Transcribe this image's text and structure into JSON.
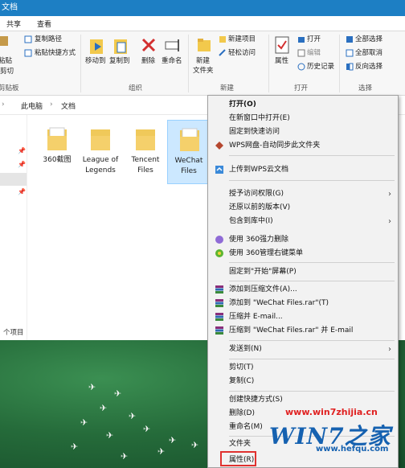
{
  "window": {
    "title": "文档"
  },
  "tabs": [
    "共享",
    "查看"
  ],
  "ribbon": {
    "clipboard": {
      "paste": "粘贴",
      "copy_path": "复制路径",
      "paste_shortcut": "粘贴快捷方式",
      "cut": "剪切",
      "group": "剪贴板"
    },
    "organize": {
      "move_to": "移动到",
      "copy_to": "复制到",
      "delete": "删除",
      "rename": "重命名",
      "group": "组织"
    },
    "new": {
      "new_folder": "新建",
      "new_folder_2": "文件夹",
      "new_item": "新建项目",
      "easy_access": "轻松访问",
      "group": "新建"
    },
    "open": {
      "properties": "属性",
      "open": "打开",
      "edit": "编辑",
      "history": "历史记录",
      "group": "打开"
    },
    "select": {
      "select_all": "全部选择",
      "select_none": "全部取消",
      "invert": "反向选择",
      "group": "选择"
    }
  },
  "address": {
    "this_pc": "此电脑",
    "documents": "文档"
  },
  "folders": [
    {
      "line1": "360截图",
      "line2": ""
    },
    {
      "line1": "League of",
      "line2": "Legends"
    },
    {
      "line1": "Tencent",
      "line2": "Files"
    },
    {
      "line1": "WeChat",
      "line2": "Files"
    }
  ],
  "status": {
    "items": "个项目"
  },
  "context_menu": [
    "打开(O)",
    "在新窗口中打开(E)",
    "固定到快速访问",
    "WPS网盘-自动同步此文件夹",
    "上传到WPS云文档",
    "授予访问权限(G)",
    "还原以前的版本(V)",
    "包含到库中(I)",
    "使用 360强力删除",
    "使用 360管理右键菜单",
    "固定到\"开始\"屏幕(P)",
    "添加到压缩文件(A)...",
    "添加到 \"WeChat Files.rar\"(T)",
    "压缩并 E-mail...",
    "压缩到 \"WeChat Files.rar\" 并 E-mail",
    "发送到(N)",
    "剪切(T)",
    "复制(C)",
    "创建快捷方式(S)",
    "删除(D)",
    "重命名(M)",
    "文件夹",
    "属性(R)"
  ],
  "watermark": {
    "url": "www.win7zhijia.cn",
    "logo": "WIN7之家",
    "site": "www.hefqu.com"
  }
}
